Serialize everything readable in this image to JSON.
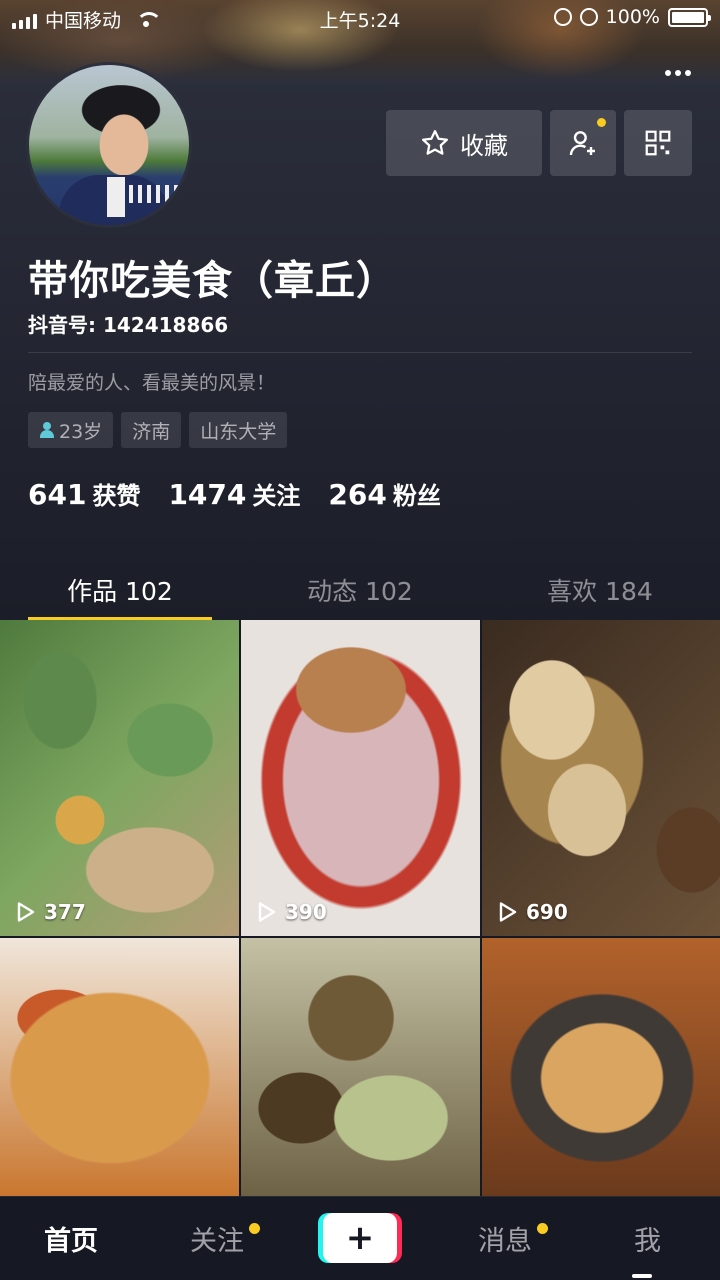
{
  "status_bar": {
    "carrier": "中国移动",
    "time": "上午5:24",
    "battery_percent": "100%"
  },
  "profile": {
    "name": "带你吃美食（章丘）",
    "douyin_id": "抖音号: 142418866",
    "bio": "陪最爱的人、看最美的风景！",
    "tags": {
      "age": "23岁",
      "city": "济南",
      "school": "山东大学"
    },
    "favorite_label": "收藏"
  },
  "stats": {
    "likes": {
      "num": "641",
      "label": "获赞"
    },
    "following": {
      "num": "1474",
      "label": "关注"
    },
    "followers": {
      "num": "264",
      "label": "粉丝"
    }
  },
  "tabs": [
    {
      "label": "作品 102",
      "active": true
    },
    {
      "label": "动态 102",
      "active": false
    },
    {
      "label": "喜欢 184",
      "active": false
    }
  ],
  "videos": [
    {
      "plays": "377"
    },
    {
      "plays": "390"
    },
    {
      "plays": "690"
    },
    {
      "plays": ""
    },
    {
      "plays": ""
    },
    {
      "plays": ""
    }
  ],
  "bottom_nav": {
    "home": "首页",
    "follow": "关注",
    "add": "+",
    "messages": "消息",
    "me": "我"
  },
  "colors": {
    "accent": "#facb21",
    "background": "#161823"
  }
}
